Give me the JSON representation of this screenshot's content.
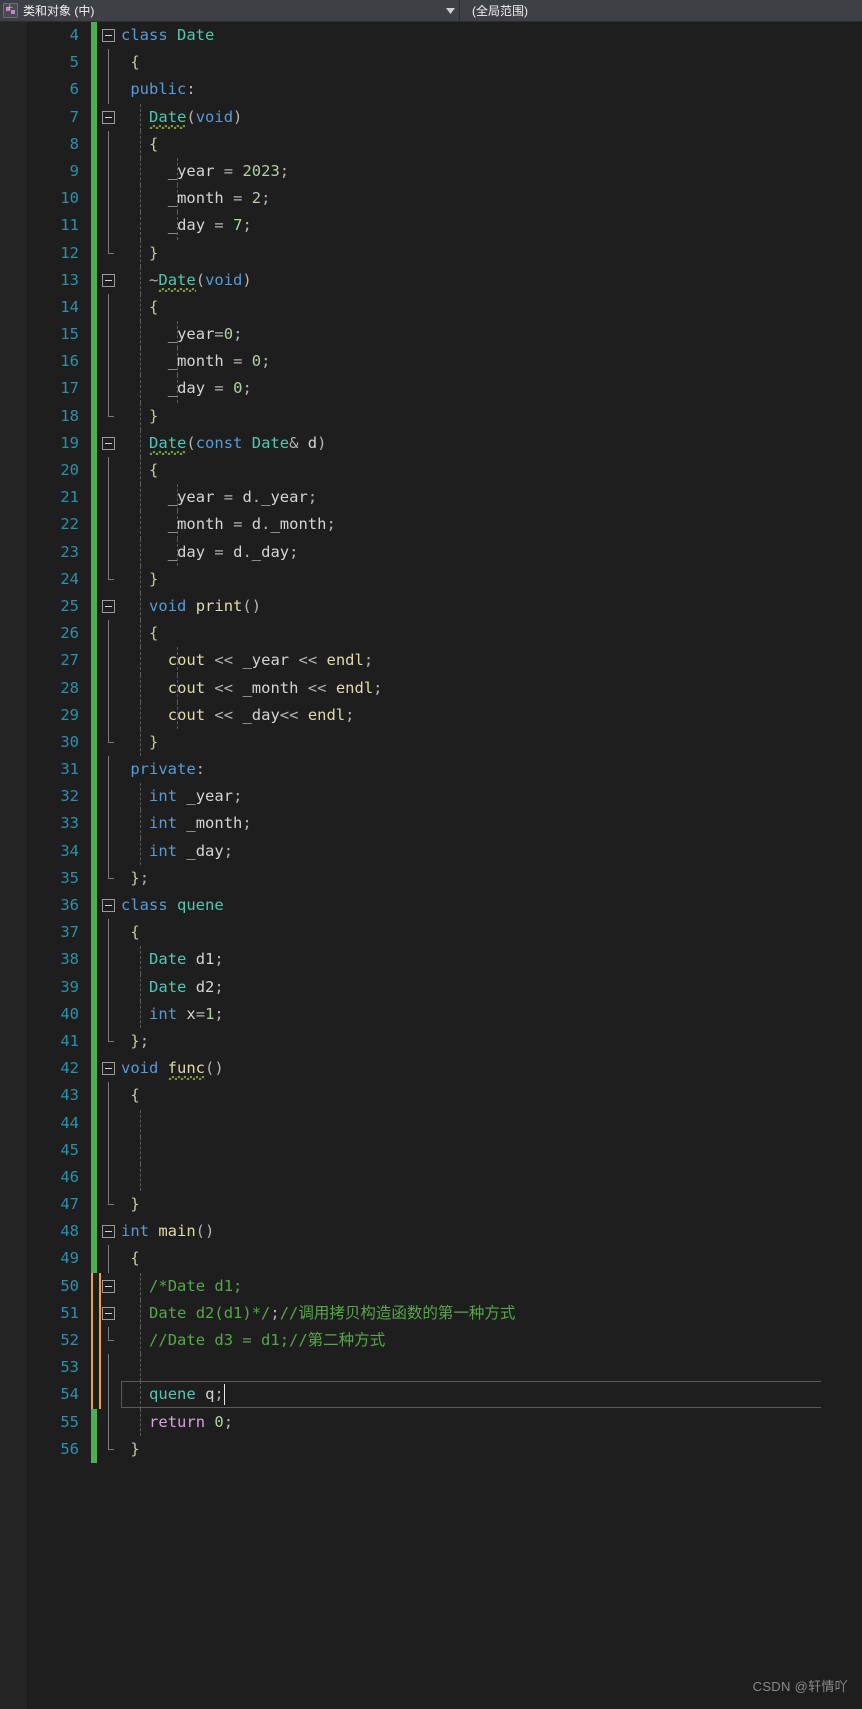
{
  "navbar": {
    "file_icon": "cpp-file-icon",
    "file_label": "类和对象 (中)",
    "dropdown_icon": "chevron-down-icon",
    "scope_label": "(全局范围)"
  },
  "editor": {
    "first_line": 4,
    "cursor_line": 54,
    "watermark": "CSDN @轩情吖",
    "lines": [
      {
        "n": 4,
        "track": "saved",
        "fold": "box",
        "guides": [],
        "indent": 0,
        "text": "class Date"
      },
      {
        "n": 5,
        "track": "saved",
        "fold": "line",
        "guides": [],
        "indent": 1,
        "text": "{"
      },
      {
        "n": 6,
        "track": "saved",
        "fold": "line",
        "guides": [],
        "indent": 1,
        "text": "public:"
      },
      {
        "n": 7,
        "track": "saved",
        "fold": "box",
        "guides": [
          1
        ],
        "indent": 3,
        "text": "Date(void)"
      },
      {
        "n": 8,
        "track": "saved",
        "fold": "line",
        "guides": [
          1
        ],
        "indent": 3,
        "text": "{"
      },
      {
        "n": 9,
        "track": "saved",
        "fold": "line",
        "guides": [
          1,
          3
        ],
        "indent": 5,
        "text": "_year = 2023;"
      },
      {
        "n": 10,
        "track": "saved",
        "fold": "line",
        "guides": [
          1,
          3
        ],
        "indent": 5,
        "text": "_month = 2;"
      },
      {
        "n": 11,
        "track": "saved",
        "fold": "line",
        "guides": [
          1,
          3
        ],
        "indent": 5,
        "text": "_day = 7;"
      },
      {
        "n": 12,
        "track": "saved",
        "fold": "line-end",
        "guides": [
          1
        ],
        "indent": 3,
        "text": "}"
      },
      {
        "n": 13,
        "track": "saved",
        "fold": "box",
        "guides": [
          1
        ],
        "indent": 3,
        "text": "~Date(void)"
      },
      {
        "n": 14,
        "track": "saved",
        "fold": "line",
        "guides": [
          1
        ],
        "indent": 3,
        "text": "{"
      },
      {
        "n": 15,
        "track": "saved",
        "fold": "line",
        "guides": [
          1,
          3
        ],
        "indent": 5,
        "text": "_year=0;"
      },
      {
        "n": 16,
        "track": "saved",
        "fold": "line",
        "guides": [
          1,
          3
        ],
        "indent": 5,
        "text": "_month = 0;"
      },
      {
        "n": 17,
        "track": "saved",
        "fold": "line",
        "guides": [
          1,
          3
        ],
        "indent": 5,
        "text": "_day = 0;"
      },
      {
        "n": 18,
        "track": "saved",
        "fold": "line-end",
        "guides": [
          1
        ],
        "indent": 3,
        "text": "}"
      },
      {
        "n": 19,
        "track": "saved",
        "fold": "box",
        "guides": [
          1
        ],
        "indent": 3,
        "text": "Date(const Date& d)"
      },
      {
        "n": 20,
        "track": "saved",
        "fold": "line",
        "guides": [
          1
        ],
        "indent": 3,
        "text": "{"
      },
      {
        "n": 21,
        "track": "saved",
        "fold": "line",
        "guides": [
          1,
          3
        ],
        "indent": 5,
        "text": "_year = d._year;"
      },
      {
        "n": 22,
        "track": "saved",
        "fold": "line",
        "guides": [
          1,
          3
        ],
        "indent": 5,
        "text": "_month = d._month;"
      },
      {
        "n": 23,
        "track": "saved",
        "fold": "line",
        "guides": [
          1,
          3
        ],
        "indent": 5,
        "text": "_day = d._day;"
      },
      {
        "n": 24,
        "track": "saved",
        "fold": "line-end",
        "guides": [
          1
        ],
        "indent": 3,
        "text": "}"
      },
      {
        "n": 25,
        "track": "saved",
        "fold": "box",
        "guides": [
          1
        ],
        "indent": 3,
        "text": "void print()"
      },
      {
        "n": 26,
        "track": "saved",
        "fold": "line",
        "guides": [
          1
        ],
        "indent": 3,
        "text": "{"
      },
      {
        "n": 27,
        "track": "saved",
        "fold": "line",
        "guides": [
          1,
          3
        ],
        "indent": 5,
        "text": "cout << _year << endl;"
      },
      {
        "n": 28,
        "track": "saved",
        "fold": "line",
        "guides": [
          1,
          3
        ],
        "indent": 5,
        "text": "cout << _month << endl;"
      },
      {
        "n": 29,
        "track": "saved",
        "fold": "line",
        "guides": [
          1,
          3
        ],
        "indent": 5,
        "text": "cout << _day<< endl;"
      },
      {
        "n": 30,
        "track": "saved",
        "fold": "line-end",
        "guides": [
          1
        ],
        "indent": 3,
        "text": "}"
      },
      {
        "n": 31,
        "track": "saved",
        "fold": "line",
        "guides": [],
        "indent": 1,
        "text": "private:"
      },
      {
        "n": 32,
        "track": "saved",
        "fold": "line",
        "guides": [
          1
        ],
        "indent": 3,
        "text": "int _year;"
      },
      {
        "n": 33,
        "track": "saved",
        "fold": "line",
        "guides": [
          1
        ],
        "indent": 3,
        "text": "int _month;"
      },
      {
        "n": 34,
        "track": "saved",
        "fold": "line",
        "guides": [
          1
        ],
        "indent": 3,
        "text": "int _day;"
      },
      {
        "n": 35,
        "track": "saved",
        "fold": "line-end",
        "guides": [],
        "indent": 1,
        "text": "};"
      },
      {
        "n": 36,
        "track": "saved",
        "fold": "box",
        "guides": [],
        "indent": 0,
        "text": "class quene"
      },
      {
        "n": 37,
        "track": "saved",
        "fold": "line",
        "guides": [],
        "indent": 1,
        "text": "{"
      },
      {
        "n": 38,
        "track": "saved",
        "fold": "line",
        "guides": [
          1
        ],
        "indent": 3,
        "text": "Date d1;"
      },
      {
        "n": 39,
        "track": "saved",
        "fold": "line",
        "guides": [
          1
        ],
        "indent": 3,
        "text": "Date d2;"
      },
      {
        "n": 40,
        "track": "saved",
        "fold": "line",
        "guides": [
          1
        ],
        "indent": 3,
        "text": "int x=1;"
      },
      {
        "n": 41,
        "track": "saved",
        "fold": "line-end",
        "guides": [],
        "indent": 1,
        "text": "};"
      },
      {
        "n": 42,
        "track": "saved",
        "fold": "box",
        "guides": [],
        "indent": 0,
        "text": "void func()"
      },
      {
        "n": 43,
        "track": "saved",
        "fold": "line",
        "guides": [],
        "indent": 1,
        "text": "{"
      },
      {
        "n": 44,
        "track": "saved",
        "fold": "line",
        "guides": [
          1
        ],
        "indent": 3,
        "text": ""
      },
      {
        "n": 45,
        "track": "saved",
        "fold": "line",
        "guides": [
          1
        ],
        "indent": 3,
        "text": ""
      },
      {
        "n": 46,
        "track": "saved",
        "fold": "line",
        "guides": [
          1
        ],
        "indent": 3,
        "text": ""
      },
      {
        "n": 47,
        "track": "saved",
        "fold": "line-end",
        "guides": [],
        "indent": 1,
        "text": "}"
      },
      {
        "n": 48,
        "track": "saved",
        "fold": "box",
        "guides": [],
        "indent": 0,
        "text": "int main()"
      },
      {
        "n": 49,
        "track": "saved",
        "fold": "line",
        "guides": [],
        "indent": 1,
        "text": "{"
      },
      {
        "n": 50,
        "track": "modified",
        "fold": "box2",
        "guides": [
          1
        ],
        "indent": 3,
        "text": "/*Date d1;"
      },
      {
        "n": 51,
        "track": "modified",
        "fold": "box2",
        "guides": [
          1
        ],
        "indent": 3,
        "text": "Date d2(d1)*/;//调用拷贝构造函数的第一种方式"
      },
      {
        "n": 52,
        "track": "modified",
        "fold": "line-end",
        "guides": [
          1
        ],
        "indent": 3,
        "text": "//Date d3 = d1;//第二种方式"
      },
      {
        "n": 53,
        "track": "modified",
        "fold": "line",
        "guides": [
          1
        ],
        "indent": 3,
        "text": ""
      },
      {
        "n": 54,
        "track": "modified",
        "fold": "line",
        "guides": [
          1
        ],
        "indent": 3,
        "text": "quene q;"
      },
      {
        "n": 55,
        "track": "saved",
        "fold": "line",
        "guides": [
          1
        ],
        "indent": 3,
        "text": "return 0;"
      },
      {
        "n": 56,
        "track": "saved",
        "fold": "line-end",
        "guides": [],
        "indent": 1,
        "text": "}"
      }
    ]
  },
  "colors": {
    "background": "#1e1e1e",
    "toolbar": "#3f3f46",
    "line_number": "#2b91af",
    "keyword": "#569cd6",
    "type_name": "#4ec9b0",
    "function": "#dcdcaa",
    "identifier": "#d4d4d4",
    "number": "#b5cea8",
    "comment": "#57a64a",
    "control_keyword": "#d8a0df",
    "saved_marker": "#4caf50",
    "modified_marker": "#e8a33d"
  }
}
